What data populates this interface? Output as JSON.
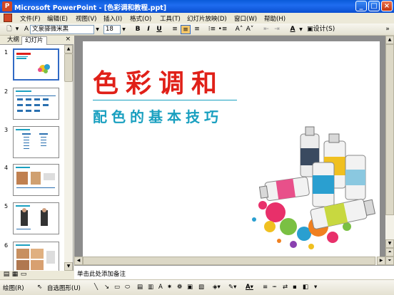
{
  "window": {
    "title": "Microsoft PowerPoint - [色彩调和教程.ppt]"
  },
  "menu": [
    "文件(F)",
    "编辑(E)",
    "视图(V)",
    "插入(I)",
    "格式(O)",
    "工具(T)",
    "幻灯片放映(D)",
    "窗口(W)",
    "帮助(H)"
  ],
  "toolbar": {
    "font": "文泉驿微米黑",
    "size": "18",
    "bold": "B",
    "italic": "I",
    "underline": "U",
    "font_color": "A",
    "design": "设计(S)"
  },
  "pane": {
    "tab_outline": "大纲",
    "tab_slides": "幻灯片",
    "close": "×"
  },
  "slides": [
    {
      "num": "1",
      "selected": true
    },
    {
      "num": "2",
      "selected": false
    },
    {
      "num": "3",
      "selected": false
    },
    {
      "num": "4",
      "selected": false
    },
    {
      "num": "5",
      "selected": false
    },
    {
      "num": "6",
      "selected": false
    }
  ],
  "slide": {
    "title": "色彩调和",
    "subtitle": "配色的基本技巧",
    "title_color": "#e02018",
    "accent_color": "#1aa0c0"
  },
  "notes": {
    "placeholder": "单击此处添加备注"
  },
  "drawbar": {
    "draw": "绘图(R)",
    "autoshapes": "自选图形(U)"
  }
}
